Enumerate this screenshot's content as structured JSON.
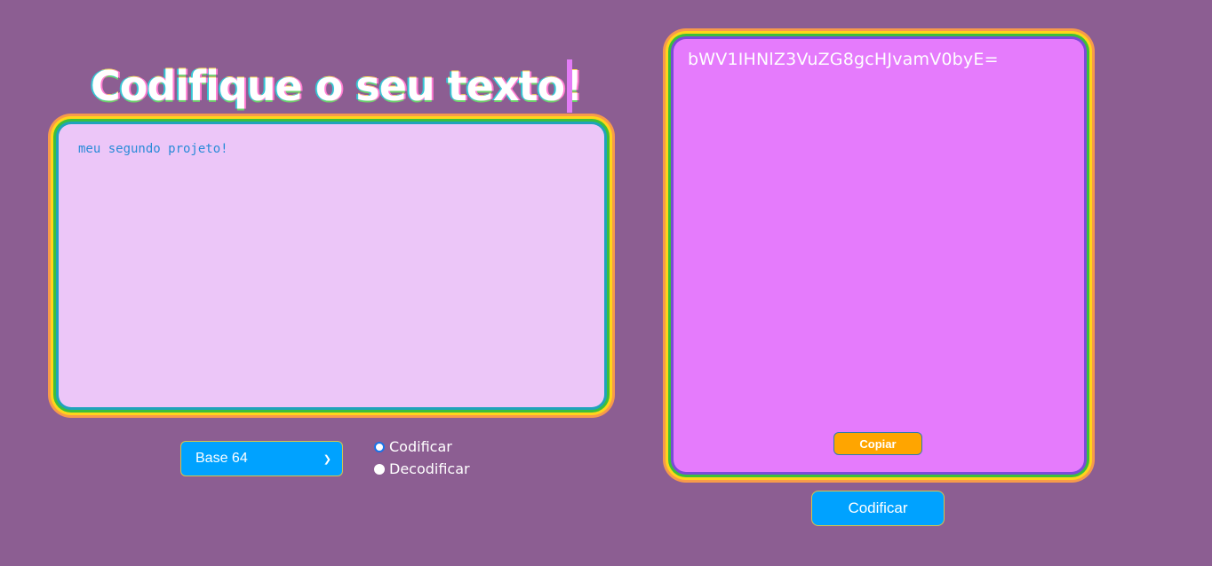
{
  "header": {
    "title": "Codifique o seu texto!"
  },
  "input": {
    "value": "meu segundo projeto!"
  },
  "output": {
    "value": "bWV1IHNlZ3VuZG8gcHJvamV0byE=",
    "copy_label": "Copiar"
  },
  "controls": {
    "method_selected": "Base 64",
    "radio_options": [
      {
        "label": "Codificar",
        "checked": true
      },
      {
        "label": "Decodificar",
        "checked": false
      }
    ],
    "action_label": "Codificar"
  },
  "colors": {
    "background": "#8c5e92",
    "input_bg": "#ecc6f8",
    "output_bg": "#e57bfc",
    "button_blue": "#00a2ff",
    "copy_orange": "#ffa500"
  }
}
